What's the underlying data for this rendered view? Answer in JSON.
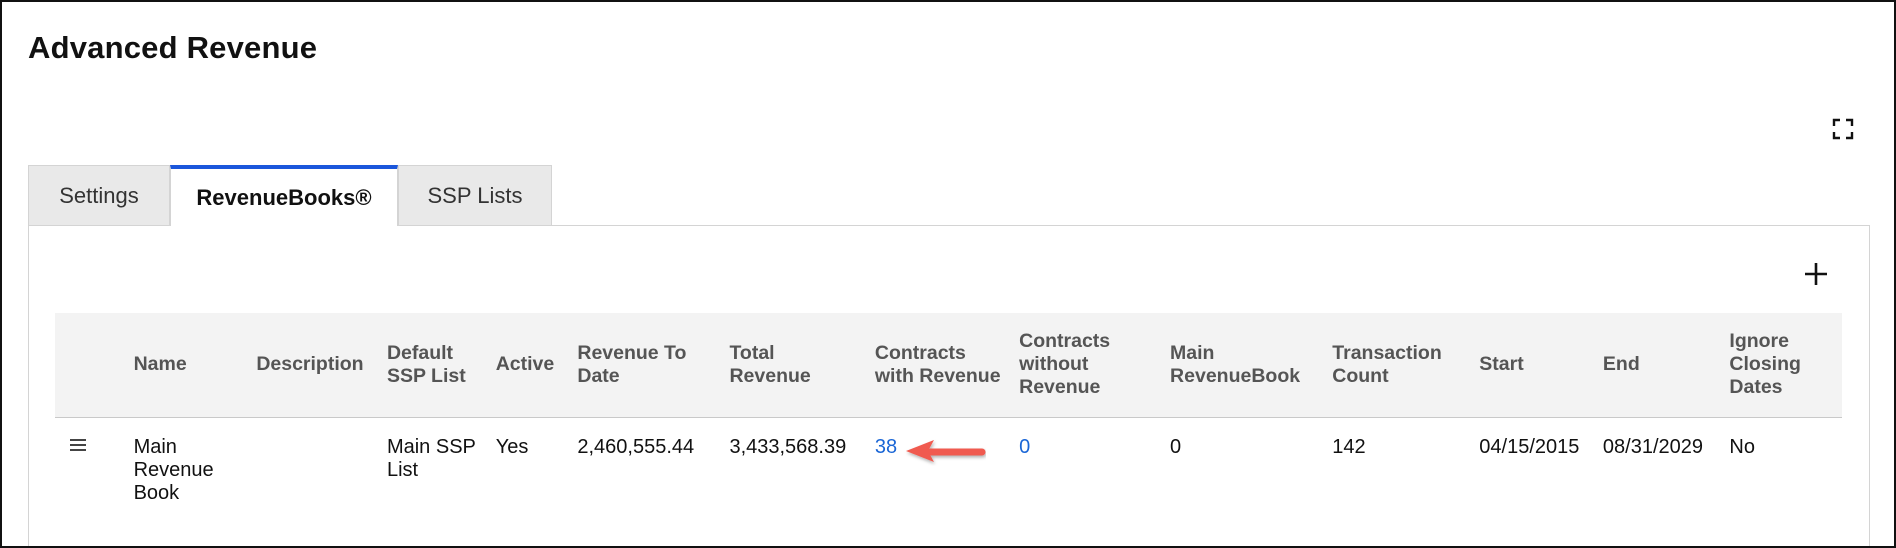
{
  "page": {
    "title": "Advanced Revenue"
  },
  "tabs": [
    {
      "label": "Settings",
      "active": false
    },
    {
      "label": "RevenueBooks®",
      "active": true
    },
    {
      "label": "SSP Lists",
      "active": false
    }
  ],
  "icons": {
    "fullscreen": "expand-icon",
    "add": "plus-icon",
    "drag": "drag-handle-icon",
    "annotation": "red-arrow"
  },
  "colors": {
    "active_tab_border": "#1a56db",
    "link": "#1a66d6",
    "arrow": "#f05a4f"
  },
  "table": {
    "columns": [
      "Name",
      "Description",
      "Default SSP List",
      "Active",
      "Revenue To Date",
      "Total Revenue",
      "Contracts with Revenue",
      "Contracts without Revenue",
      "Main RevenueBook",
      "Transaction Count",
      "Start",
      "End",
      "Ignore Closing Dates"
    ],
    "rows": [
      {
        "name": "Main Revenue Book",
        "description": "",
        "default_ssp_list": "Main SSP List",
        "active": "Yes",
        "revenue_to_date": "2,460,555.44",
        "total_revenue": "3,433,568.39",
        "contracts_with_revenue": "38",
        "contracts_without_revenue": "0",
        "main_revenuebook": "0",
        "transaction_count": "142",
        "start": "04/15/2015",
        "end": "08/31/2029",
        "ignore_closing_dates": "No"
      }
    ]
  }
}
